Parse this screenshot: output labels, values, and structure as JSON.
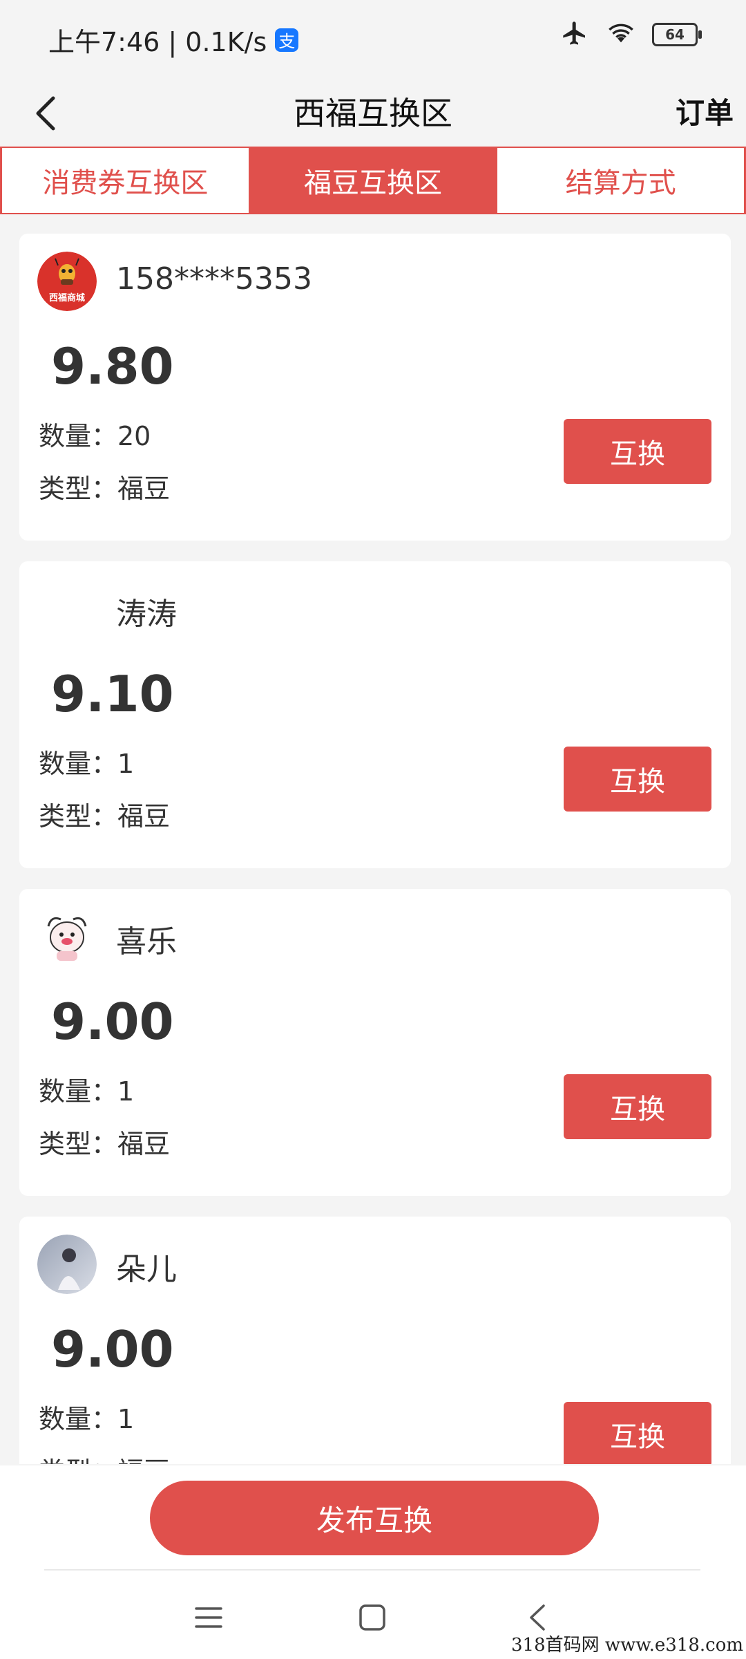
{
  "status_bar": {
    "time_speed": "上午7:46 | 0.1K/s",
    "alipay_icon_label": "支",
    "battery": "64"
  },
  "header": {
    "title": "西福互换区",
    "right_link": "订单"
  },
  "tabs": [
    {
      "label": "消费券互换区",
      "active": false
    },
    {
      "label": "福豆互换区",
      "active": true
    },
    {
      "label": "结算方式",
      "active": false
    }
  ],
  "cards": [
    {
      "avatar": "mall-logo-avatar",
      "avatar_text": "西福商城",
      "username": "158****5353",
      "price": "9.80",
      "qty": "数量：20",
      "type": "类型：福豆",
      "button": "互换"
    },
    {
      "avatar": "none",
      "username": "涛涛",
      "price": "9.10",
      "qty": "数量：1",
      "type": "类型：福豆",
      "button": "互换"
    },
    {
      "avatar": "cartoon-avatar",
      "username": "喜乐",
      "price": "9.00",
      "qty": "数量：1",
      "type": "类型：福豆",
      "button": "互换"
    },
    {
      "avatar": "photo-avatar",
      "username": "朵儿",
      "price": "9.00",
      "qty": "数量：1",
      "type": "类型：福豆",
      "button": "互换"
    }
  ],
  "publish_button": "发布互换",
  "watermark": "318首码网  www.e318.com",
  "colors": {
    "accent": "#e0504c",
    "background": "#f4f4f4"
  }
}
